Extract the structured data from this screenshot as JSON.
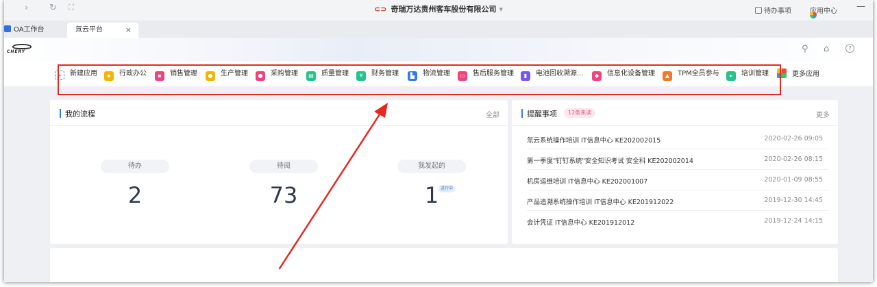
{
  "window": {
    "company": "奇瑞万达贵州客车股份有限公司",
    "todo_label": "待办事项",
    "app_center_label": "应用中心"
  },
  "tabs": [
    {
      "label": "OA工作台"
    },
    {
      "label": "氚云平台",
      "close": "×"
    }
  ],
  "header": {
    "logo_text": "CHERY"
  },
  "apps": [
    {
      "label": "新建应用",
      "color": "#ffffff"
    },
    {
      "label": "行政办公",
      "color": "#f5b400"
    },
    {
      "label": "销售管理",
      "color": "#f0427c"
    },
    {
      "label": "生产管理",
      "color": "#f5b400"
    },
    {
      "label": "采购管理",
      "color": "#f0427c"
    },
    {
      "label": "质量管理",
      "color": "#25c38b"
    },
    {
      "label": "财务管理",
      "color": "#25c38b"
    },
    {
      "label": "物流管理",
      "color": "#3377f5"
    },
    {
      "label": "售后服务管理",
      "color": "#f0427c"
    },
    {
      "label": "电池回收溯源...",
      "color": "#7a55f0"
    },
    {
      "label": "信息化设备管理",
      "color": "#f0427c"
    },
    {
      "label": "TPM全员参与",
      "color": "#f07a2a"
    },
    {
      "label": "培训管理",
      "color": "#25c38b"
    },
    {
      "label": "更多应用",
      "color": "multi"
    }
  ],
  "my_flow": {
    "title": "我的流程",
    "link": "全部",
    "stats": [
      {
        "label": "待办",
        "value": "2"
      },
      {
        "label": "待阅",
        "value": "73"
      },
      {
        "label": "我发起的",
        "value": "1",
        "tag": "进行中"
      }
    ]
  },
  "reminders": {
    "title": "提醒事项",
    "badge": "12条未读",
    "link": "更多",
    "items": [
      {
        "text": "氚云系统操作培训 IT信息中心 KE202002015",
        "time": "2020-02-26 09:05"
      },
      {
        "text": "第一季度\"钉钉系统\"安全知识考试 安全科 KE202002014",
        "time": "2020-02-26 08:15"
      },
      {
        "text": "机房运维培训 IT信息中心 KE202001007",
        "time": "2020-01-09 08:55"
      },
      {
        "text": "产品追溯系统操作培训 IT信息中心 KE201912022",
        "time": "2019-12-30 14:45"
      },
      {
        "text": "会计凭证 IT信息中心 KE201912012",
        "time": "2019-12-24 14:15"
      }
    ]
  }
}
